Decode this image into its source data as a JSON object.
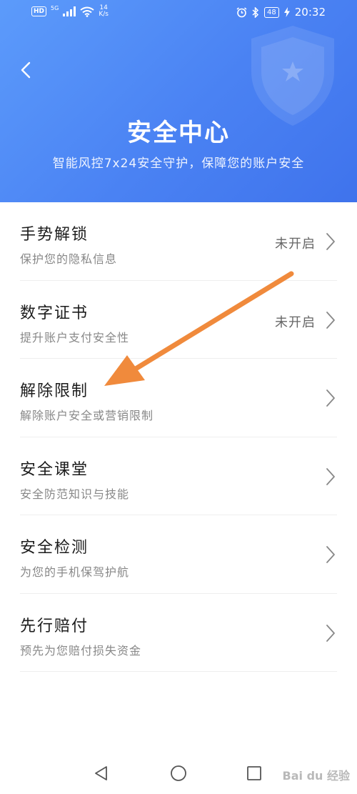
{
  "status_bar": {
    "network_badge": "HD",
    "network_type": "5G",
    "speed_value": "14",
    "speed_unit": "K/s",
    "battery": "48",
    "time": "20:32"
  },
  "header": {
    "title": "安全中心",
    "subtitle": "智能风控7x24安全守护，保障您的账户安全",
    "back_icon": "chevron-left-icon",
    "decor_icon": "shield-icon"
  },
  "items": [
    {
      "title": "手势解锁",
      "desc": "保护您的隐私信息",
      "status": "未开启"
    },
    {
      "title": "数字证书",
      "desc": "提升账户支付安全性",
      "status": "未开启"
    },
    {
      "title": "解除限制",
      "desc": "解除账户安全或营销限制",
      "status": ""
    },
    {
      "title": "安全课堂",
      "desc": "安全防范知识与技能",
      "status": ""
    },
    {
      "title": "安全检测",
      "desc": "为您的手机保驾护航",
      "status": ""
    },
    {
      "title": "先行赔付",
      "desc": "预先为您赔付损失资金",
      "status": ""
    }
  ],
  "annotation": {
    "color": "#f08a3c",
    "target": "解除限制"
  },
  "navbar": {
    "back": "triangle-back-icon",
    "home": "circle-home-icon",
    "recents": "square-recents-icon"
  },
  "watermark": "Bai du 经验",
  "colors": {
    "header_start": "#5c9bfb",
    "header_end": "#3f73ec",
    "arrow": "#f08a3c"
  }
}
